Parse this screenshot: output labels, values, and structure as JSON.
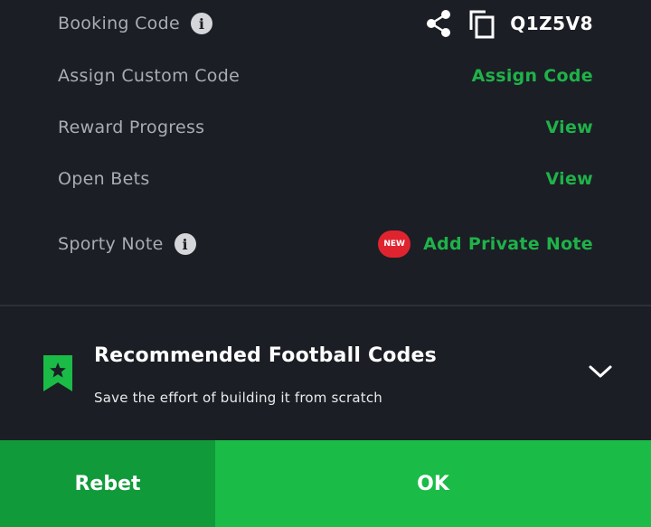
{
  "rows": {
    "booking": {
      "label": "Booking Code",
      "code": "Q1Z5V8",
      "info_icon": "info-icon",
      "share_icon": "share-icon",
      "copy_icon": "copy-icon"
    },
    "assign": {
      "label": "Assign Custom Code",
      "action": "Assign Code"
    },
    "reward": {
      "label": "Reward Progress",
      "action": "View"
    },
    "open_bets": {
      "label": "Open Bets",
      "action": "View"
    },
    "note": {
      "label": "Sporty Note",
      "badge": "NEW",
      "action": "Add Private Note"
    }
  },
  "recommended": {
    "title": "Recommended Football Codes",
    "subtitle": "Save the effort of building it from scratch",
    "icon": "bookmark-star-icon",
    "toggle_icon": "chevron-down-icon"
  },
  "footer": {
    "rebet_label": "Rebet",
    "ok_label": "OK"
  },
  "colors": {
    "background": "#1b1e24",
    "accent_green": "#1fb24a",
    "button_dark_green": "#109a3a",
    "button_green": "#1abb46",
    "badge_red": "#e0242f"
  }
}
